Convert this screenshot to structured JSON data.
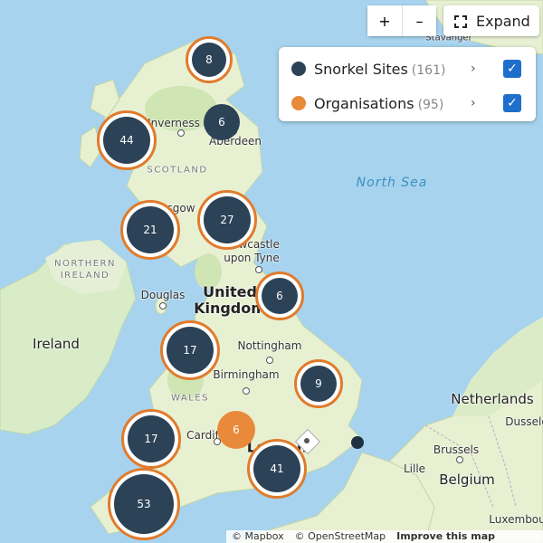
{
  "controls": {
    "zoom_in_label": "+",
    "zoom_out_label": "–",
    "expand_label": "Expand"
  },
  "legend": {
    "items": [
      {
        "name": "Snorkel Sites",
        "count": "(161)",
        "color": "#2b4257",
        "checked": true,
        "chevron": "›"
      },
      {
        "name": "Organisations",
        "count": "(95)",
        "color": "#e88a3a",
        "checked": true,
        "chevron": "›"
      }
    ],
    "check_mark": "✓"
  },
  "map_labels": {
    "north_sea": "North Sea",
    "united_kingdom": "United Kingdom",
    "ireland": "Ireland",
    "northern_ireland": "NORTHERN IRELAND",
    "scotland": "SCOTLAND",
    "wales": "WALES",
    "inverness": "Inverness",
    "aberdeen": "Aberdeen",
    "glasgow": "Glasgow",
    "newcastle": "Newcastle upon Tyne",
    "douglas": "Douglas",
    "nottingham": "Nottingham",
    "birmingham": "Birmingham",
    "cardiff": "Cardiff",
    "london": "London",
    "netherlands": "Netherlands",
    "brussels": "Brussels",
    "belgium": "Belgium",
    "lille": "Lille",
    "dusseldorf": "Dusselo",
    "luxembourg": "Luxembour",
    "stavanger": "Stavanger"
  },
  "clusters": [
    {
      "id": "8",
      "label": "8",
      "type": "site"
    },
    {
      "id": "6a",
      "label": "6",
      "type": "site-plain"
    },
    {
      "id": "44",
      "label": "44",
      "type": "site"
    },
    {
      "id": "21",
      "label": "21",
      "type": "site"
    },
    {
      "id": "27",
      "label": "27",
      "type": "site"
    },
    {
      "id": "6b",
      "label": "6",
      "type": "site"
    },
    {
      "id": "17a",
      "label": "17",
      "type": "site"
    },
    {
      "id": "9",
      "label": "9",
      "type": "site"
    },
    {
      "id": "6org",
      "label": "6",
      "type": "org"
    },
    {
      "id": "17b",
      "label": "17",
      "type": "site"
    },
    {
      "id": "41",
      "label": "41",
      "type": "site"
    },
    {
      "id": "53",
      "label": "53",
      "type": "site"
    }
  ],
  "attribution": {
    "mapbox": "© Mapbox",
    "osm": "© OpenStreetMap",
    "improve": "Improve this map"
  },
  "colors": {
    "site": "#2b4257",
    "org": "#e88a3a",
    "ring": "#e07b2c",
    "water": "#a7d3ee",
    "check": "#1e6fcc"
  }
}
